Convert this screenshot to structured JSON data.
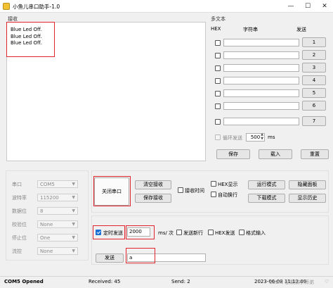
{
  "window": {
    "title": "小鱼儿串口助手-1.0",
    "minimize": "—",
    "maximize": "☐",
    "close": "✕"
  },
  "receive": {
    "label": "接收",
    "lines": [
      "Blue Led Off.",
      "Blue Led Off.",
      "Blue Led Off."
    ]
  },
  "multi": {
    "label": "多文本",
    "col_hex": "HEX",
    "col_str": "字符串",
    "col_send": "发送",
    "rows": [
      {
        "send": "1"
      },
      {
        "send": "2"
      },
      {
        "send": "3"
      },
      {
        "send": "4"
      },
      {
        "send": "5"
      },
      {
        "send": "6"
      },
      {
        "send": "7"
      }
    ],
    "loop_label": "循环发送",
    "loop_ms": "500",
    "ms": "ms",
    "save": "保存",
    "load": "载入",
    "reset": "重置"
  },
  "serial": {
    "port_label": "串口",
    "port": "COM5",
    "baud_label": "波特率",
    "baud": "115200",
    "data_label": "数据位",
    "data": "8",
    "parity_label": "校验位",
    "parity": "None",
    "stop_label": "停止位",
    "stop": "One",
    "flow_label": "流控",
    "flow": "None"
  },
  "controls": {
    "close_port": "关闭串口",
    "clear_recv": "清空接收",
    "save_recv": "保存接收",
    "recv_time": "接收时间",
    "hex_display": "HEX显示",
    "auto_wrap": "自动换行",
    "run_mode": "运行模式",
    "hide_panel": "隐藏面板",
    "download_mode": "下载模式",
    "show_history": "显示历史"
  },
  "send": {
    "timed_label": "定时发送",
    "interval": "2000",
    "unit": "ms/ 次",
    "newline": "发送新行",
    "hex_send": "HEX发送",
    "format_input": "格式输入",
    "send_button": "发送",
    "text": "a"
  },
  "status": {
    "port": "COM5 Opened",
    "received": "Received: 45",
    "sent": "Send: 2",
    "time": "2023-06-08 11:12:09",
    "watermark": "CSDN @果果小师弟",
    "heart": "♡"
  }
}
